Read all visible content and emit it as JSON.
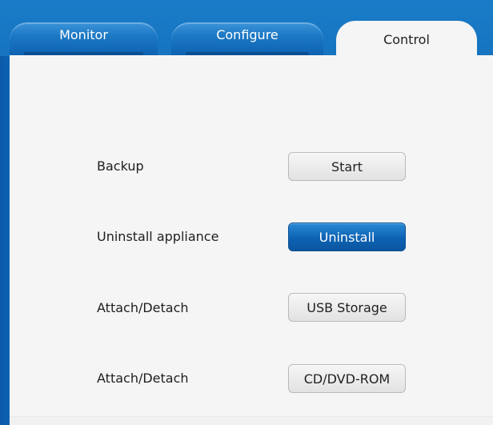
{
  "tabs": [
    {
      "label": "Monitor",
      "active": false
    },
    {
      "label": "Configure",
      "active": false
    },
    {
      "label": "Control",
      "active": true
    }
  ],
  "rows": [
    {
      "label": "Backup",
      "button": "Start",
      "style": "secondary"
    },
    {
      "label": "Uninstall appliance",
      "button": "Uninstall",
      "style": "primary"
    },
    {
      "label": "Attach/Detach",
      "button": "USB Storage",
      "style": "secondary"
    },
    {
      "label": "Attach/Detach",
      "button": "CD/DVD-ROM",
      "style": "secondary"
    }
  ],
  "colors": {
    "frame_blue": "#0b5fae",
    "primary_button": "#0d62b2",
    "content_bg": "#f5f5f5"
  }
}
